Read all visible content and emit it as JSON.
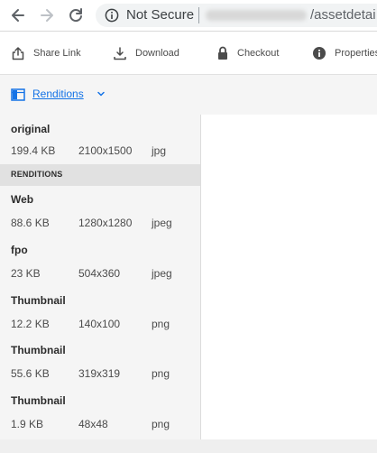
{
  "browser": {
    "security_label": "Not Secure",
    "url_path": "/assetdetai"
  },
  "toolbar": {
    "share_label": "Share Link",
    "download_label": "Download",
    "checkout_label": "Checkout",
    "properties_label": "Properties"
  },
  "renditions_menu": {
    "label": "Renditions"
  },
  "original": {
    "name": "original",
    "size": "199.4 KB",
    "dimensions": "2100x1500",
    "format": "jpg"
  },
  "section_title": "RENDITIONS",
  "renditions": [
    {
      "name": "Web",
      "size": "88.6 KB",
      "dimensions": "1280x1280",
      "format": "jpeg"
    },
    {
      "name": "fpo",
      "size": "23 KB",
      "dimensions": "504x360",
      "format": "jpeg"
    },
    {
      "name": "Thumbnail",
      "size": "12.2 KB",
      "dimensions": "140x100",
      "format": "png"
    },
    {
      "name": "Thumbnail",
      "size": "55.6 KB",
      "dimensions": "319x319",
      "format": "png"
    },
    {
      "name": "Thumbnail",
      "size": "1.9 KB",
      "dimensions": "48x48",
      "format": "png"
    }
  ],
  "colors": {
    "link_blue": "#1473e6",
    "panel_bg": "#f5f5f5",
    "section_bg": "#e1e1e1"
  }
}
